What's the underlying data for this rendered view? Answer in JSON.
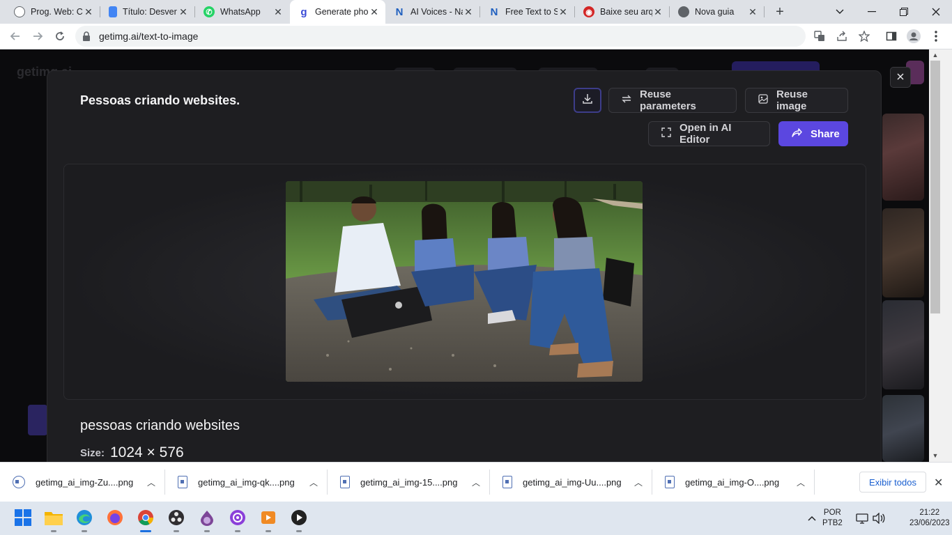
{
  "browser": {
    "tabs": [
      {
        "title": "Prog. Web: Cr",
        "icon": "chatgpt-icon",
        "color": "#6b6b6b"
      },
      {
        "title": "Título: Desver",
        "icon": "google-docs-icon",
        "color": "#4285f4"
      },
      {
        "title": "WhatsApp",
        "icon": "whatsapp-icon",
        "color": "#25d366"
      },
      {
        "title": "Generate pho",
        "icon": "getimg-icon",
        "color": "#3a4bd6"
      },
      {
        "title": "AI Voices - Na",
        "icon": "naturalreaders-icon",
        "color": "#1f5fbf"
      },
      {
        "title": "Free Text to S",
        "icon": "naturalreaders-icon",
        "color": "#1f5fbf"
      },
      {
        "title": "Baixe seu arq",
        "icon": "adobe-icon",
        "color": "#d32626"
      },
      {
        "title": "Nova guia",
        "icon": "chrome-icon",
        "color": "#5f6368"
      }
    ],
    "url": "getimg.ai/text-to-image"
  },
  "background_page": {
    "logo": "getimg.ai"
  },
  "modal": {
    "title": "Pessoas criando websites.",
    "reuse_parameters": "Reuse parameters",
    "reuse_image": "Reuse image",
    "open_editor": "Open in AI Editor",
    "share": "Share",
    "prompt": "pessoas criando websites",
    "size_label": "Size:",
    "size_value": "1024 × 576",
    "accent": "#5b47e0"
  },
  "downloads": {
    "items": [
      "getimg_ai_img-Zu....png",
      "getimg_ai_img-qk....png",
      "getimg_ai_img-15....png",
      "getimg_ai_img-Uu....png",
      "getimg_ai_img-O....png"
    ],
    "show_all": "Exibir todos"
  },
  "taskbar": {
    "apps": [
      "windows-start-icon",
      "file-explorer-icon",
      "edge-icon",
      "firefox-icon",
      "chrome-icon",
      "obs-icon",
      "tor-icon",
      "podcast-icon",
      "media-player-icon",
      "audio-app-icon"
    ],
    "lang_line1": "POR",
    "lang_line2": "PTB2",
    "time": "21:22",
    "date": "23/06/2023"
  }
}
